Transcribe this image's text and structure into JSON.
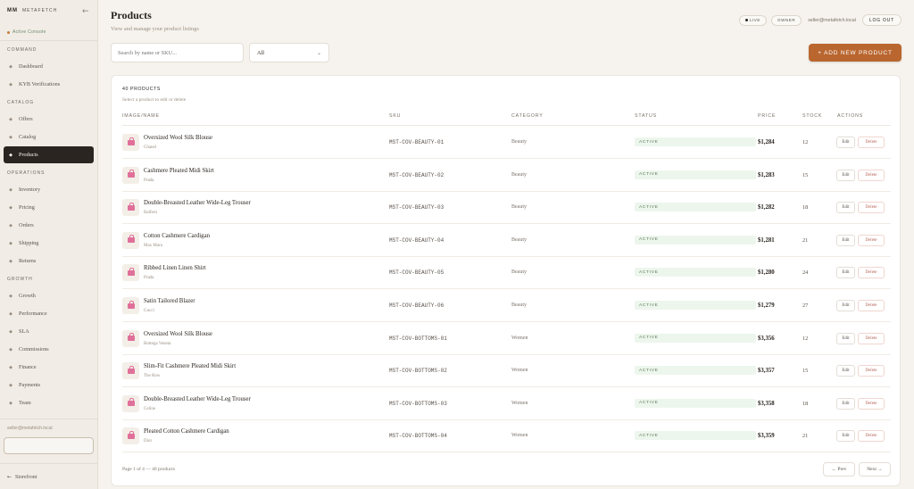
{
  "sidebar": {
    "brand_logo": "MM",
    "brand_name": "METAFETCH",
    "collapse_icon": "←",
    "status_text": "Active Console",
    "sections": [
      {
        "title": "COMMAND",
        "items": [
          {
            "label": "Dashboard"
          },
          {
            "label": "KYB Verifications"
          }
        ]
      },
      {
        "title": "CATALOG",
        "items": [
          {
            "label": "Offers"
          },
          {
            "label": "Catalog"
          },
          {
            "label": "Products"
          }
        ]
      },
      {
        "title": "OPERATIONS",
        "items": [
          {
            "label": "Inventory"
          },
          {
            "label": "Pricing"
          },
          {
            "label": "Orders"
          },
          {
            "label": "Shipping"
          },
          {
            "label": "Returns"
          }
        ]
      },
      {
        "title": "GROWTH",
        "items": [
          {
            "label": "Growth"
          },
          {
            "label": "Performance"
          },
          {
            "label": "SLA"
          },
          {
            "label": "Commissions"
          },
          {
            "label": "Finance"
          },
          {
            "label": "Payments"
          },
          {
            "label": "Team"
          }
        ]
      }
    ],
    "active_item": "Products",
    "user_email": "seller@metafetch.local",
    "storefront_label": "Storefront",
    "storefront_icon": "←"
  },
  "header": {
    "title": "Products",
    "subtitle": "View and manage your product listings",
    "live_label": "LIVE",
    "owner_label": "OWNER",
    "email": "seller@metafetch.local",
    "logout_label": "LOG OUT"
  },
  "toolbar": {
    "search_placeholder": "Search by name or SKU...",
    "filter_value": "All",
    "add_button_label": "+ ADD NEW PRODUCT"
  },
  "table": {
    "count_label": "40 PRODUCTS",
    "hint": "Select a product to edit or delete",
    "columns": [
      "IMAGE/NAME",
      "SKU",
      "CATEGORY",
      "STATUS",
      "PRICE",
      "STOCK",
      "ACTIONS"
    ],
    "edit_label": "Edit",
    "delete_label": "Delete",
    "rows": [
      {
        "name": "Oversized Wool Silk Blouse",
        "brand": "Chanel",
        "sku": "MST-COV-BEAUTY-01",
        "category": "Beauty",
        "status": "ACTIVE",
        "price": "$1,284",
        "stock": "12"
      },
      {
        "name": "Cashmere Pleated Midi Skirt",
        "brand": "Prada",
        "sku": "MST-COV-BEAUTY-02",
        "category": "Beauty",
        "status": "ACTIVE",
        "price": "$1,283",
        "stock": "15"
      },
      {
        "name": "Double-Breasted Leather Wide-Leg Trouser",
        "brand": "Balfern",
        "sku": "MST-COV-BEAUTY-03",
        "category": "Beauty",
        "status": "ACTIVE",
        "price": "$1,282",
        "stock": "18"
      },
      {
        "name": "Cotton Cashmere Cardigan",
        "brand": "Max Mara",
        "sku": "MST-COV-BEAUTY-04",
        "category": "Beauty",
        "status": "ACTIVE",
        "price": "$1,281",
        "stock": "21"
      },
      {
        "name": "Ribbed Linen Linen Shirt",
        "brand": "Prada",
        "sku": "MST-COV-BEAUTY-05",
        "category": "Beauty",
        "status": "ACTIVE",
        "price": "$1,280",
        "stock": "24"
      },
      {
        "name": "Satin Tailored Blazer",
        "brand": "Gucci",
        "sku": "MST-COV-BEAUTY-06",
        "category": "Beauty",
        "status": "ACTIVE",
        "price": "$1,279",
        "stock": "27"
      },
      {
        "name": "Oversized Wool Silk Blouse",
        "brand": "Bottega Veneta",
        "sku": "MST-COV-BOTTOMS-01",
        "category": "Women",
        "status": "ACTIVE",
        "price": "$3,356",
        "stock": "12"
      },
      {
        "name": "Slim-Fit Cashmere Pleated Midi Skirt",
        "brand": "The Row",
        "sku": "MST-COV-BOTTOMS-02",
        "category": "Women",
        "status": "ACTIVE",
        "price": "$3,357",
        "stock": "15"
      },
      {
        "name": "Double-Breasted Leather Wide-Leg Trouser",
        "brand": "Celine",
        "sku": "MST-COV-BOTTOMS-03",
        "category": "Women",
        "status": "ACTIVE",
        "price": "$3,358",
        "stock": "18"
      },
      {
        "name": "Pleated Cotton Cashmere Cardigan",
        "brand": "Dior",
        "sku": "MST-COV-BOTTOMS-04",
        "category": "Women",
        "status": "ACTIVE",
        "price": "$3,359",
        "stock": "21"
      }
    ]
  },
  "pagination": {
    "info": "Page 1 of 4 — 40 products",
    "prev_label": "← Prev",
    "next_label": "Next →"
  },
  "colors": {
    "accent": "#b9662f",
    "active_nav": "#2a2520",
    "status_bg": "#edf6ec",
    "delete_text": "#b8655a"
  },
  "icons": {
    "nav_bullet": "nav-diamond-icon",
    "product_thumb": "shopping-bag-icon",
    "select_chevron": "chevron-down-icon"
  }
}
